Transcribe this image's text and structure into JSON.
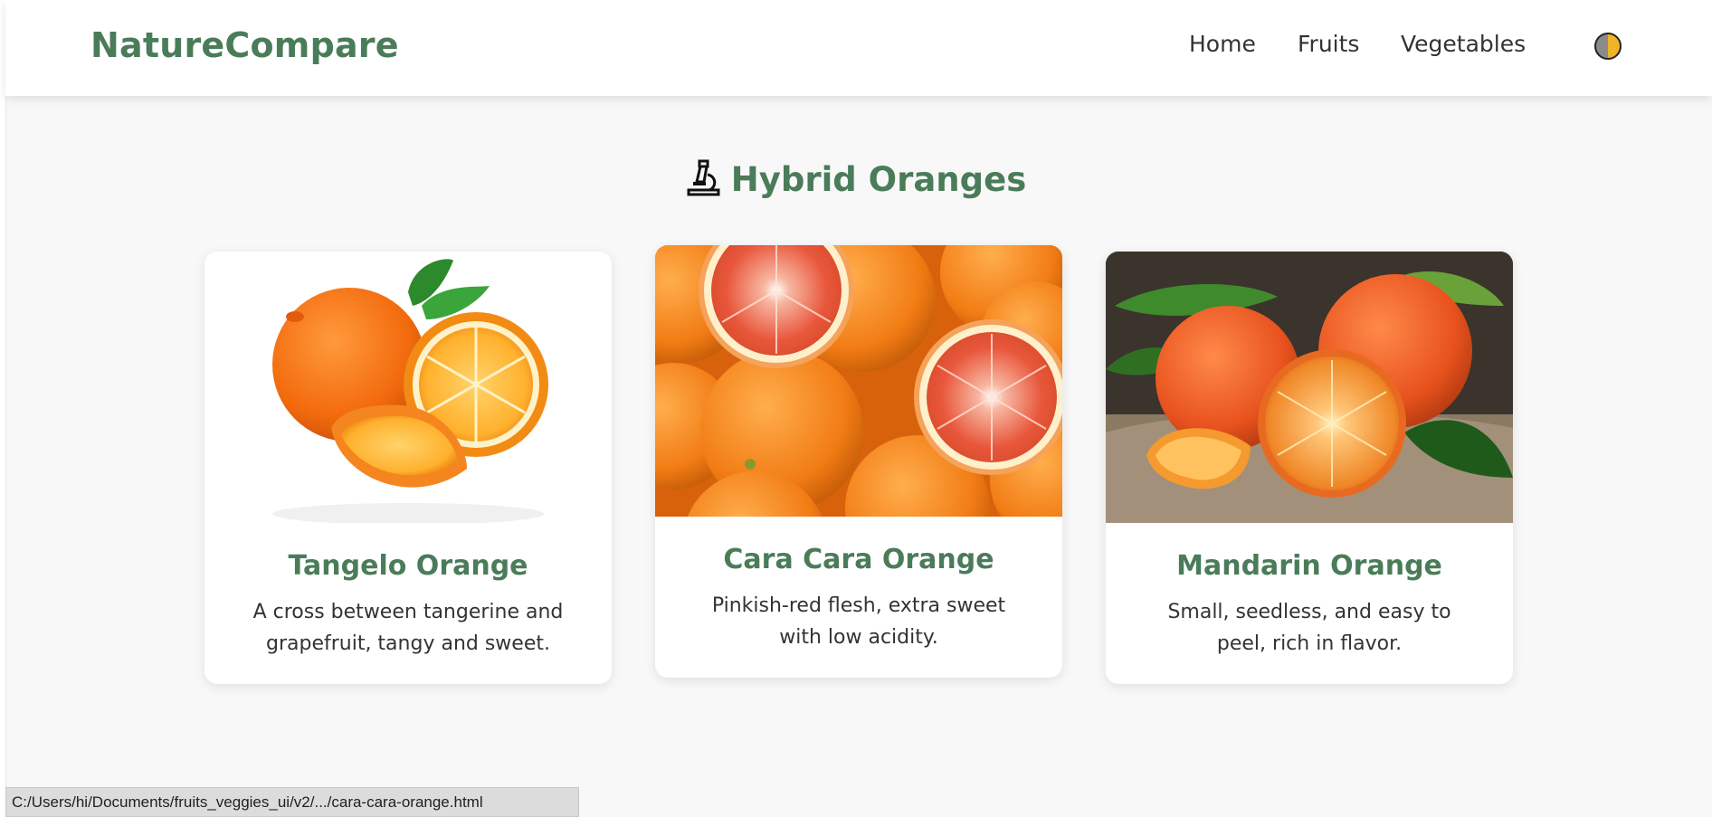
{
  "header": {
    "brand": "NatureCompare",
    "nav": [
      "Home",
      "Fruits",
      "Vegetables"
    ],
    "theme_toggle_icon": "half-moon-icon"
  },
  "section": {
    "title": "Hybrid Oranges",
    "icon": "microscope-icon"
  },
  "cards": [
    {
      "title": "Tangelo Orange",
      "description": "A cross between tangerine and grapefruit, tangy and sweet.",
      "image": "tangelo-orange-image"
    },
    {
      "title": "Cara Cara Orange",
      "description": "Pinkish-red flesh, extra sweet with low acidity.",
      "image": "cara-cara-orange-image"
    },
    {
      "title": "Mandarin Orange",
      "description": "Small, seedless, and easy to peel, rich in flavor.",
      "image": "mandarin-orange-image"
    }
  ],
  "status_bar": {
    "url": "C:/Users/hi/Documents/fruits_veggies_ui/v2/.../cara-cara-orange.html"
  },
  "colors": {
    "brand_green": "#4a7c59",
    "background": "#f8f8f8",
    "card_bg": "#ffffff",
    "orange": "#f5851f"
  }
}
